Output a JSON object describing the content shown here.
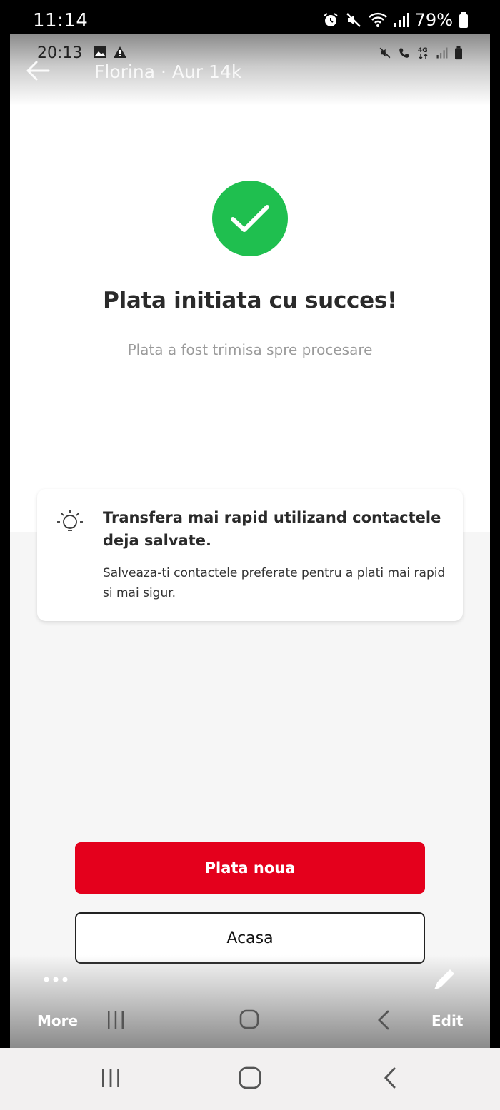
{
  "outer_status_bar": {
    "time": "11:14",
    "battery": "79%",
    "icons": [
      "alarm-icon",
      "mute-icon",
      "wifi-icon",
      "signal-icon",
      "battery-icon"
    ]
  },
  "inner_status_bar": {
    "time": "20:13",
    "left_icons": [
      "image-icon",
      "warning-icon"
    ],
    "right_icons": [
      "mute-icon",
      "call-icon",
      "4g-icon",
      "signal-icon",
      "battery-icon"
    ]
  },
  "viewer": {
    "title": "Florina · Aur 14k",
    "more_label": "More",
    "edit_label": "Edit"
  },
  "success": {
    "title": "Plata initiata cu succes!",
    "subtitle": "Plata a fost trimisa spre procesare",
    "accent_color": "#1fbf4f"
  },
  "tip_card": {
    "title": "Transfera mai rapid utilizand contactele deja salvate.",
    "body": "Salveaza-ti contactele preferate pentru a plati mai rapid si mai sigur."
  },
  "actions": {
    "primary_label": "Plata noua",
    "secondary_label": "Acasa",
    "primary_color": "#e4001c"
  }
}
